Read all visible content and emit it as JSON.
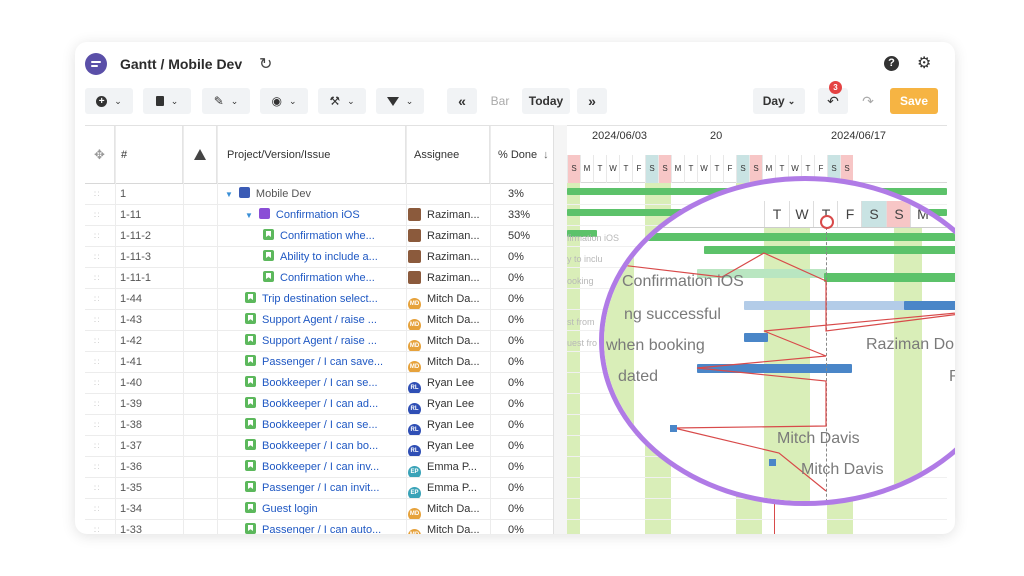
{
  "header": {
    "title": "Gantt / Mobile Dev",
    "refresh_icon": "refresh-icon",
    "help_icon": "help-icon",
    "help_glyph": "?",
    "settings_icon": "gear-icon"
  },
  "toolbar": {
    "add_icon": "plus-circle-icon",
    "delete_icon": "trash-icon",
    "edit_icon": "pencil-icon",
    "view_icon": "eye-icon",
    "tools_icon": "wrench-icon",
    "filter_icon": "filter-icon",
    "prev_icon": "double-chevron-left-icon",
    "bar_label": "Bar",
    "today_label": "Today",
    "next_icon": "double-chevron-right-icon",
    "scale_label": "Day",
    "undo_badge": "3",
    "save_label": "Save",
    "save_color": "#f6b443"
  },
  "columns": {
    "drag": "",
    "num": "#",
    "warning_icon": "warning-icon",
    "project": "Project/Version/Issue",
    "assignee": "Assignee",
    "percent": "% Done"
  },
  "rows": [
    {
      "num": "1",
      "warn": "",
      "title": "Mobile Dev",
      "assignee": "",
      "pct": "3%"
    },
    {
      "num": "1-11",
      "warn": "orange",
      "title": "Confirmation iOS",
      "assignee": "Raziman...",
      "pct": "33%"
    },
    {
      "num": "1-11-2",
      "warn": "orange",
      "title": "Confirmation whe...",
      "assignee": "Raziman...",
      "pct": "50%"
    },
    {
      "num": "1-11-3",
      "warn": "orange",
      "title": "Ability to include a...",
      "assignee": "Raziman...",
      "pct": "0%"
    },
    {
      "num": "1-11-1",
      "warn": "orange",
      "title": "Confirmation whe...",
      "assignee": "Raziman...",
      "pct": "0%"
    },
    {
      "num": "1-44",
      "warn": "",
      "title": "Trip destination select...",
      "assignee": "Mitch Da...",
      "pct": "0%"
    },
    {
      "num": "1-43",
      "warn": "red",
      "title": "Support Agent / raise ...",
      "assignee": "Mitch Da...",
      "pct": "0%"
    },
    {
      "num": "1-42",
      "warn": "red",
      "title": "Support Agent / raise ...",
      "assignee": "Mitch Da...",
      "pct": "0%"
    },
    {
      "num": "1-41",
      "warn": "",
      "title": "Passenger / I can save...",
      "assignee": "Mitch Da...",
      "pct": "0%"
    },
    {
      "num": "1-40",
      "warn": "",
      "title": "Bookkeeper / I can se...",
      "assignee": "Ryan Lee",
      "pct": "0%"
    },
    {
      "num": "1-39",
      "warn": "",
      "title": "Bookkeeper / I can ad...",
      "assignee": "Ryan Lee",
      "pct": "0%"
    },
    {
      "num": "1-38",
      "warn": "",
      "title": "Bookkeeper / I can se...",
      "assignee": "Ryan Lee",
      "pct": "0%"
    },
    {
      "num": "1-37",
      "warn": "",
      "title": "Bookkeeper / I can bo...",
      "assignee": "Ryan Lee",
      "pct": "0%"
    },
    {
      "num": "1-36",
      "warn": "",
      "title": "Bookkeeper / I can inv...",
      "assignee": "Emma P...",
      "pct": "0%"
    },
    {
      "num": "1-35",
      "warn": "",
      "title": "Passenger / I can invit...",
      "assignee": "Emma P...",
      "pct": "0%"
    },
    {
      "num": "1-34",
      "warn": "",
      "title": "Guest login",
      "assignee": "Mitch Da...",
      "pct": "0%"
    },
    {
      "num": "1-33",
      "warn": "",
      "title": "Passenger / I can auto...",
      "assignee": "Mitch Da...",
      "pct": "0%"
    }
  ],
  "avatars": {
    "MD": "MD",
    "RL": "RL",
    "EP": "EP"
  },
  "timeline": {
    "weeks": [
      "2024/06/03",
      "20",
      "2024/06/17"
    ],
    "days": [
      "S",
      "M",
      "T",
      "W",
      "T",
      "F",
      "S",
      "S",
      "M",
      "T",
      "W",
      "T",
      "F",
      "S",
      "S",
      "M",
      "T",
      "W",
      "T",
      "F",
      "S",
      "S"
    ],
    "weekend_color": "#d9eeb8",
    "weekend_header_color": "#c9e3e3",
    "today_header_color": "#f7c6c6"
  },
  "zoom": {
    "days": [
      "T",
      "W",
      "T",
      "F",
      "S",
      "S",
      "M"
    ],
    "labels": {
      "confirmation_ios": "Confirmation iOS",
      "successful": "ng successful",
      "when_booking": "when booking",
      "dated": "dated",
      "raziman1": "Raziman Dom",
      "raziman2": "Razima",
      "mitch1": "Mitch Davis",
      "mitch2": "Mitch Davis"
    },
    "ghost": {
      "confirmation": "firmation iOS",
      "to_inclu": "y to inclu",
      "ooking": "ooking",
      "st_from": "st from",
      "uest_fro": "uest fro"
    }
  }
}
